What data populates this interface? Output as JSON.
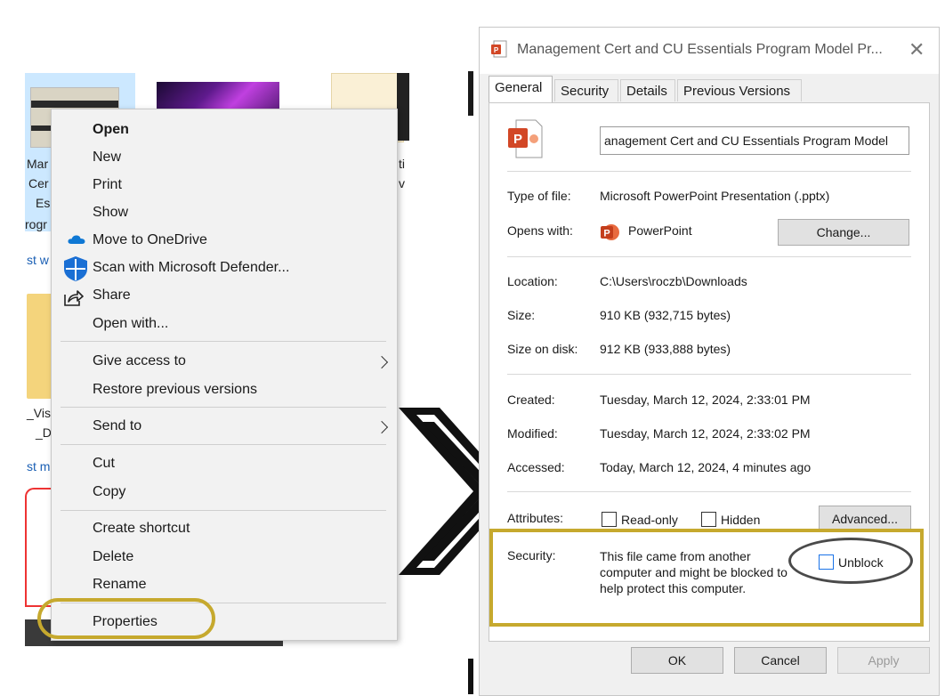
{
  "explorer": {
    "file1_lines": [
      "Mar",
      "Cer",
      "Es",
      "rogr"
    ],
    "file1_extra": "st w",
    "file2_lines": [
      "ti",
      "v"
    ],
    "file3_lines": [
      "_Vis",
      "_D"
    ],
    "file3_extra": "st m"
  },
  "context_menu": {
    "items": [
      {
        "label": "Open"
      },
      {
        "label": "New"
      },
      {
        "label": "Print"
      },
      {
        "label": "Show"
      },
      {
        "label": "Move to OneDrive",
        "icon": "onedrive-icon"
      },
      {
        "label": "Scan with Microsoft Defender...",
        "icon": "defender-icon"
      },
      {
        "label": "Share",
        "icon": "share-icon"
      },
      {
        "label": "Open with..."
      },
      {
        "label": "Give access to",
        "submenu": true
      },
      {
        "label": "Restore previous versions"
      },
      {
        "label": "Send to",
        "submenu": true
      },
      {
        "label": "Cut"
      },
      {
        "label": "Copy"
      },
      {
        "label": "Create shortcut"
      },
      {
        "label": "Delete"
      },
      {
        "label": "Rename"
      },
      {
        "label": "Properties",
        "highlighted": true
      }
    ]
  },
  "dialog": {
    "title": "Management Cert and CU Essentials Program Model Pr...",
    "tabs": [
      "General",
      "Security",
      "Details",
      "Previous Versions"
    ],
    "active_tab": "General",
    "file_name": "anagement Cert and CU Essentials Program Model",
    "type_label": "Type of file:",
    "type_value": "Microsoft PowerPoint Presentation (.pptx)",
    "opens_label": "Opens with:",
    "opens_value": "PowerPoint",
    "change_button": "Change...",
    "location_label": "Location:",
    "location_value": "C:\\Users\\roczb\\Downloads",
    "size_label": "Size:",
    "size_value": "910 KB (932,715 bytes)",
    "size_disk_label": "Size on disk:",
    "size_disk_value": "912 KB (933,888 bytes)",
    "created_label": "Created:",
    "created_value": "Tuesday, March 12, 2024, 2:33:01 PM",
    "modified_label": "Modified:",
    "modified_value": "Tuesday, March 12, 2024, 2:33:02 PM",
    "accessed_label": "Accessed:",
    "accessed_value": "Today, March 12, 2024, 4 minutes ago",
    "attributes_label": "Attributes:",
    "readonly_label": "Read-only",
    "hidden_label": "Hidden",
    "advanced_button": "Advanced...",
    "security_label": "Security:",
    "security_text": [
      "This file came from another",
      "computer and might be blocked to",
      "help protect this computer."
    ],
    "unblock_label": "Unblock",
    "ok_button": "OK",
    "cancel_button": "Cancel",
    "apply_button": "Apply"
  },
  "colors": {
    "highlight": "#c6a92e",
    "powerpoint": "#d24726",
    "onedrive": "#0f78d4",
    "defender": "#1a6fd4"
  }
}
